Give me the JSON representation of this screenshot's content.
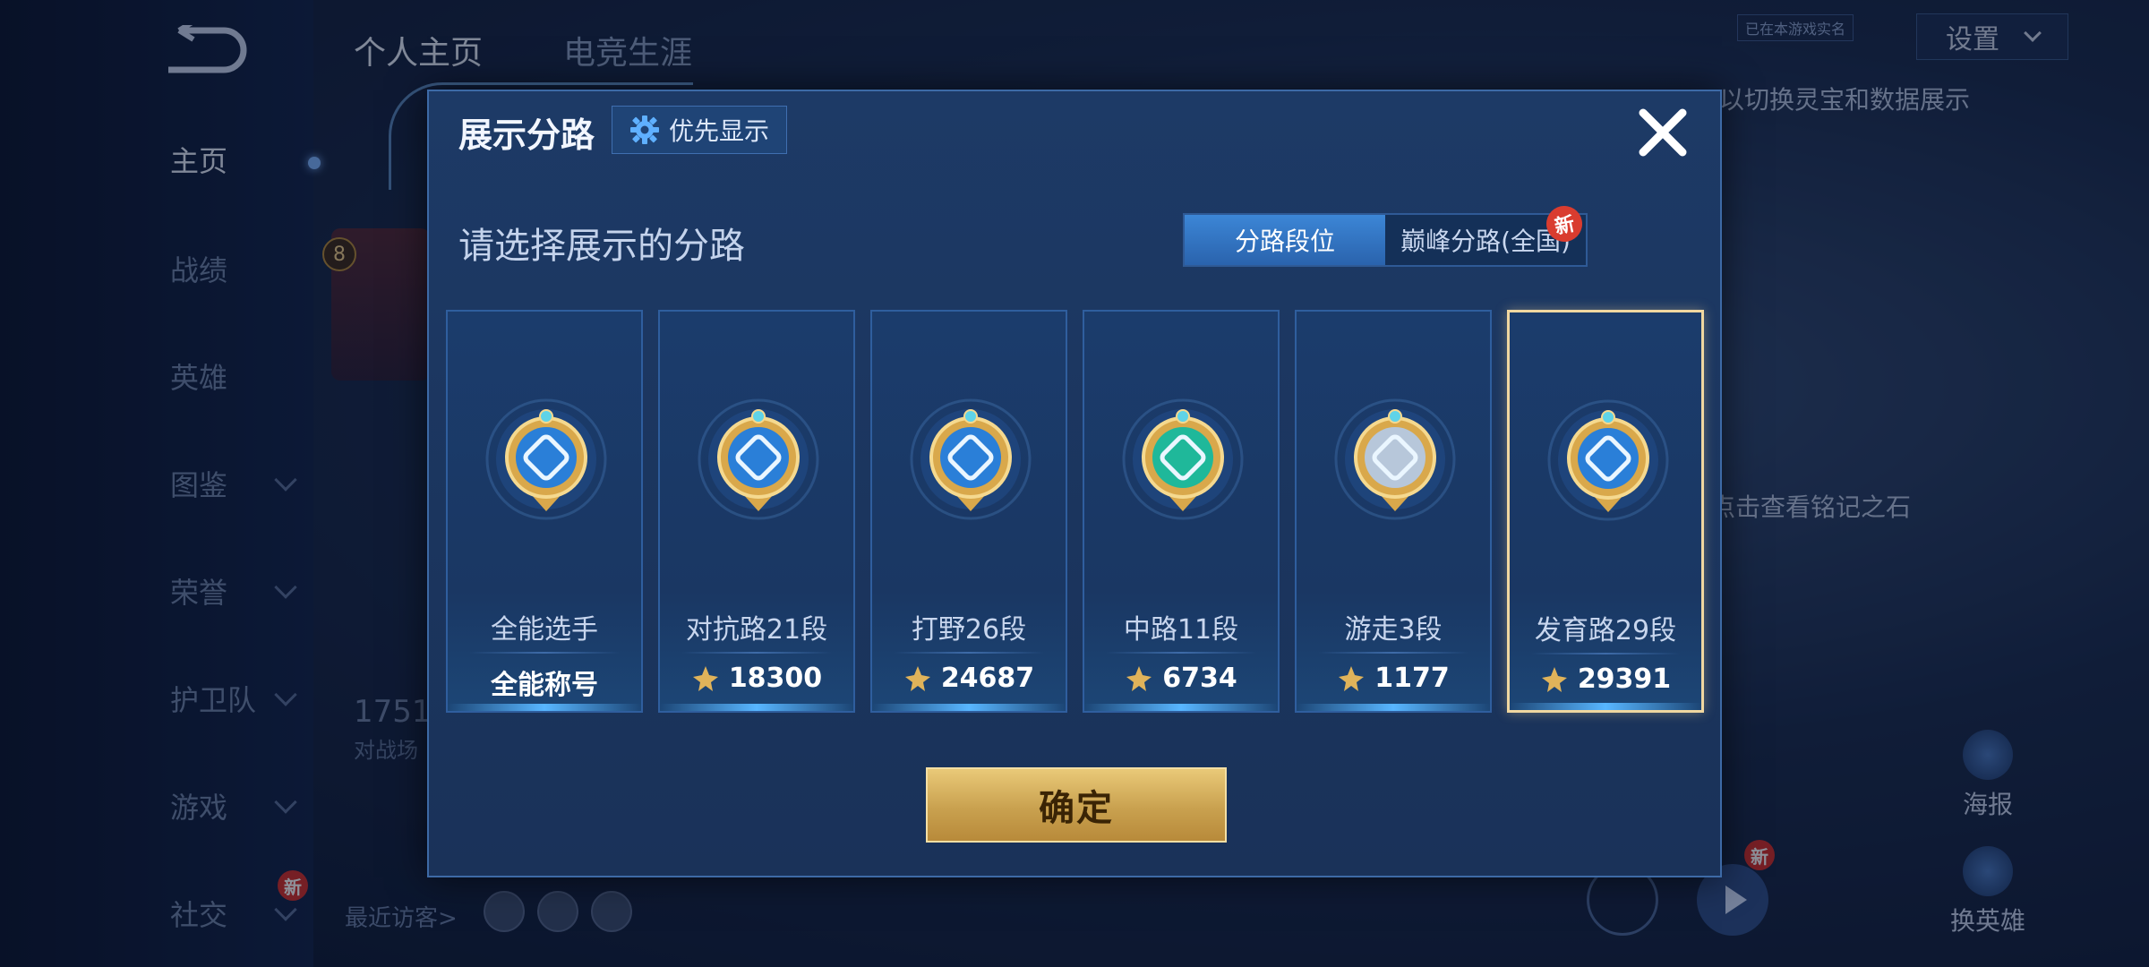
{
  "background": {
    "top_tabs": [
      "个人主页",
      "电竞生涯"
    ],
    "nav": [
      {
        "label": "主页",
        "chevron": false
      },
      {
        "label": "战绩",
        "chevron": false
      },
      {
        "label": "英雄",
        "chevron": false
      },
      {
        "label": "图鉴",
        "chevron": true
      },
      {
        "label": "荣誉",
        "chevron": true
      },
      {
        "label": "护卫队",
        "chevron": true
      },
      {
        "label": "游戏",
        "chevron": true
      },
      {
        "label": "社交",
        "chevron": true
      }
    ],
    "settings_label": "设置",
    "tag_text": "已在本游戏实名",
    "hint_top": "以切换灵宝和数据展示",
    "hint_mid": "点击查看铭记之石",
    "level": "8",
    "stat_value": "1751",
    "stat_label": "对战场",
    "recent_label": "最近访客>",
    "new_badge": "新",
    "poster_label": "海报",
    "swap_hero_label": "换英雄"
  },
  "modal": {
    "title": "展示分路",
    "priority_label": "优先显示",
    "subtitle": "请选择展示的分路",
    "tabs": [
      {
        "label": "分路段位",
        "active": true
      },
      {
        "label": "巅峰分路(全国)",
        "active": false,
        "badge": "新"
      }
    ],
    "cards": [
      {
        "name": "全能选手",
        "score": "全能称号",
        "has_icon": false,
        "icon": "all-round-emblem",
        "color": "#2a7fd8",
        "selected": false
      },
      {
        "name": "对抗路21段",
        "score": "18300",
        "has_icon": true,
        "icon": "clash-lane-emblem",
        "color": "#2a7fd8",
        "selected": false
      },
      {
        "name": "打野26段",
        "score": "24687",
        "has_icon": true,
        "icon": "jungle-emblem",
        "color": "#2a7fd8",
        "selected": false
      },
      {
        "name": "中路11段",
        "score": "6734",
        "has_icon": true,
        "icon": "mid-lane-emblem",
        "color": "#1fb89a",
        "selected": false
      },
      {
        "name": "游走3段",
        "score": "1177",
        "has_icon": true,
        "icon": "roam-emblem",
        "color": "#9fb4cc",
        "selected": false
      },
      {
        "name": "发育路29段",
        "score": "29391",
        "has_icon": true,
        "icon": "farm-lane-emblem",
        "color": "#2a7fd8",
        "selected": true
      }
    ],
    "confirm_label": "确定"
  }
}
